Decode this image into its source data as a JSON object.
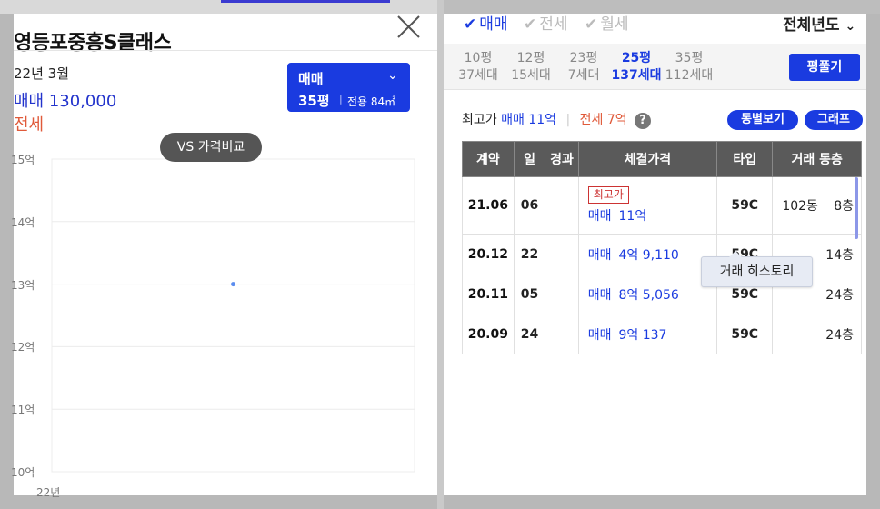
{
  "detail": {
    "title": "영등포중흥S클래스",
    "date": "22년 3월",
    "sale_price": "매매 130,000",
    "jeonse_label": "전세",
    "trade_box": {
      "type": "매매",
      "pyeong": "35평",
      "area": "전용 84㎡"
    },
    "vs_button": "VS 가격비교"
  },
  "chart_data": {
    "type": "scatter",
    "y_ticks": [
      "15억",
      "14억",
      "13억",
      "12억",
      "11억",
      "10억"
    ],
    "x_ticks": [
      "22년"
    ],
    "ylim": [
      10,
      15
    ],
    "points": [
      {
        "y": 13.0
      }
    ],
    "color": "#5b8def"
  },
  "filters": {
    "sale": "매매",
    "jeonse": "전세",
    "monthly": "월세",
    "year_select": "전체년도"
  },
  "size_tabs": [
    {
      "pyeong": "10평",
      "units": "37세대",
      "active": false
    },
    {
      "pyeong": "12평",
      "units": "15세대",
      "active": false
    },
    {
      "pyeong": "23평",
      "units": "7세대",
      "active": false
    },
    {
      "pyeong": "25평",
      "units": "137세대",
      "active": true
    },
    {
      "pyeong": "35평",
      "units": "112세대",
      "active": false
    }
  ],
  "size_button": "평풀기",
  "max_price": {
    "label": "최고가",
    "sale": "매매 11억",
    "jeonse": "전세 7억"
  },
  "buttons": {
    "by_building": "동별보기",
    "graph": "그래프"
  },
  "table": {
    "headers": [
      "계약",
      "일",
      "경과",
      "체결가격",
      "타입",
      "거래 동층"
    ],
    "max_badge": "최고가",
    "rows": [
      {
        "date": "21.06",
        "day": "06",
        "elapsed": "",
        "kind": "매매",
        "price": "11억",
        "type": "59C",
        "building": "102동",
        "floor": "8층",
        "max": true
      },
      {
        "date": "20.12",
        "day": "22",
        "elapsed": "",
        "kind": "매매",
        "price": "4억 9,110",
        "type": "59C",
        "building": "",
        "floor": "14층",
        "max": false
      },
      {
        "date": "20.11",
        "day": "05",
        "elapsed": "",
        "kind": "매매",
        "price": "8억 5,056",
        "type": "59C",
        "building": "",
        "floor": "24층",
        "max": false
      },
      {
        "date": "20.09",
        "day": "24",
        "elapsed": "",
        "kind": "매매",
        "price": "9억 137",
        "type": "59C",
        "building": "",
        "floor": "24층",
        "max": false
      }
    ]
  },
  "tooltip": "거래 히스토리",
  "colors": {
    "accent": "#1a3be0",
    "jeonse": "#e05a3a",
    "header": "#5a5a5a"
  }
}
